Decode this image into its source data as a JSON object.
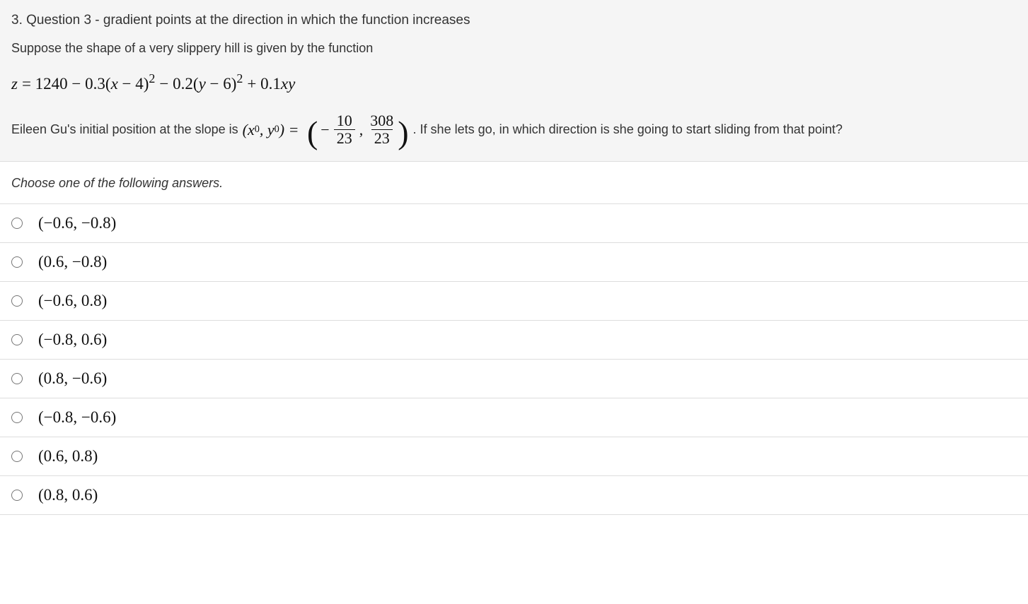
{
  "question": {
    "title": "3. Question 3 - gradient points at the direction in which the function increases",
    "prompt_intro": "Suppose the shape of a very slippery hill is given by the function",
    "equation_text": "z = 1240 − 0.3(x − 4)² − 0.2(y − 6)² + 0.1xy",
    "position_prefix": "Eileen Gu's initial position at the slope is ",
    "position_point_label": "(x₀, y₀) = ",
    "position_value": {
      "x_num": "10",
      "x_den": "23",
      "y_num": "308",
      "y_den": "23",
      "x_sign": "−"
    },
    "position_suffix": ". If she lets go, in which direction is she going to start sliding from that point?"
  },
  "instructions": "Choose one of the following answers.",
  "options": [
    {
      "label": "(−0.6, −0.8)"
    },
    {
      "label": "(0.6, −0.8)"
    },
    {
      "label": "(−0.6, 0.8)"
    },
    {
      "label": "(−0.8, 0.6)"
    },
    {
      "label": "(0.8, −0.6)"
    },
    {
      "label": "(−0.8, −0.6)"
    },
    {
      "label": "(0.6, 0.8)"
    },
    {
      "label": "(0.8, 0.6)"
    }
  ]
}
